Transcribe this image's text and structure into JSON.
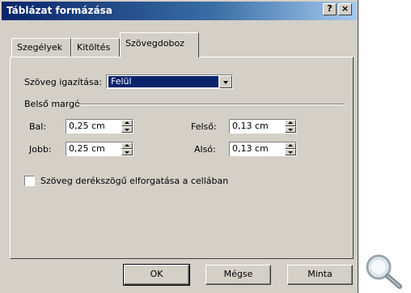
{
  "window": {
    "title": "Táblázat formázása",
    "help_label": "?",
    "close_label": "×"
  },
  "tabs": [
    {
      "label": "Szegélyek"
    },
    {
      "label": "Kitöltés"
    },
    {
      "label": "Szövegdoboz"
    }
  ],
  "alignment": {
    "label": "Szöveg igazítása:",
    "value": "Felül"
  },
  "margins": {
    "group_label": "Belső margó",
    "left": {
      "label": "Bal:",
      "value": "0,25 cm"
    },
    "right": {
      "label": "Jobb:",
      "value": "0,25 cm"
    },
    "top": {
      "label": "Felső:",
      "value": "0,13 cm"
    },
    "bottom": {
      "label": "Alsó:",
      "value": "0,13 cm"
    }
  },
  "rotate_checkbox": {
    "label": "Szöveg derékszögű elforgatása a cellában",
    "checked": false
  },
  "buttons": {
    "ok": "OK",
    "cancel": "Mégse",
    "sample": "Minta"
  },
  "colors": {
    "titlebar": "#0a246a",
    "face": "#d4d0c8",
    "selection": "#0a246a"
  },
  "icons": {
    "magnifier": "magnifier-icon"
  }
}
